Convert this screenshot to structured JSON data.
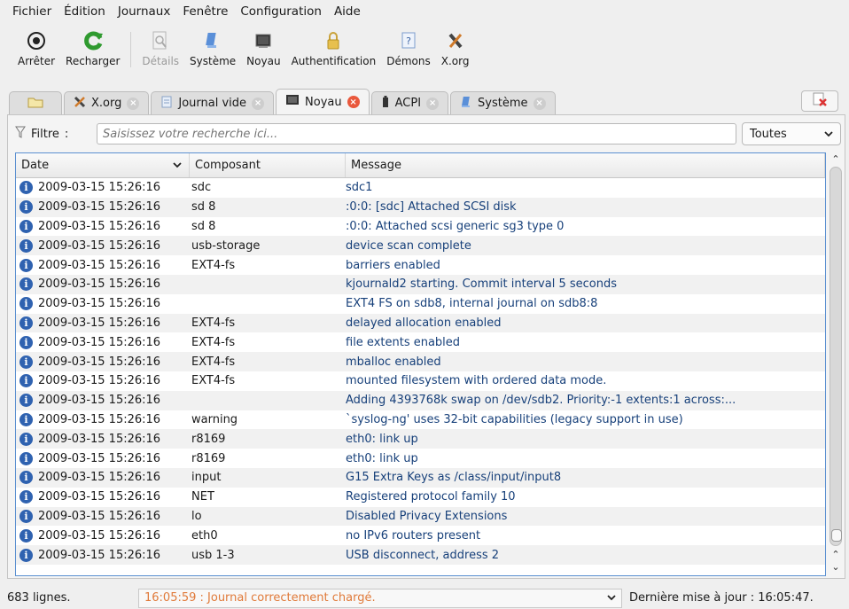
{
  "menubar": {
    "items": [
      "Fichier",
      "Édition",
      "Journaux",
      "Fenêtre",
      "Configuration",
      "Aide"
    ]
  },
  "toolbar": {
    "stop_label": "Arrêter",
    "reload_label": "Recharger",
    "details_label": "Détails",
    "system_label": "Système",
    "kernel_label": "Noyau",
    "auth_label": "Authentification",
    "daemons_label": "Démons",
    "xorg_label": "X.org"
  },
  "tabs": {
    "items": [
      {
        "label": "X.org",
        "active": false
      },
      {
        "label": "Journal vide",
        "active": false
      },
      {
        "label": "Noyau",
        "active": true
      },
      {
        "label": "ACPI",
        "active": false
      },
      {
        "label": "Système",
        "active": false
      }
    ]
  },
  "filter": {
    "label": "Filtre",
    "separator": ":",
    "placeholder": "Saisissez votre recherche ici...",
    "scope": "Toutes"
  },
  "table": {
    "columns": [
      "Date",
      "Composant",
      "Message"
    ],
    "rows": [
      {
        "date": "2009-03-15 15:26:16",
        "component": "sdc",
        "message": "sdc1"
      },
      {
        "date": "2009-03-15 15:26:16",
        "component": "sd 8",
        "message": ":0:0: [sdc] Attached SCSI disk"
      },
      {
        "date": "2009-03-15 15:26:16",
        "component": "sd 8",
        "message": ":0:0: Attached scsi generic sg3 type 0"
      },
      {
        "date": "2009-03-15 15:26:16",
        "component": "usb-storage",
        "message": "device scan complete"
      },
      {
        "date": "2009-03-15 15:26:16",
        "component": "EXT4-fs",
        "message": "barriers enabled"
      },
      {
        "date": "2009-03-15 15:26:16",
        "component": "",
        "message": "kjournald2 starting. Commit interval 5 seconds"
      },
      {
        "date": "2009-03-15 15:26:16",
        "component": "",
        "message": "EXT4 FS on sdb8, internal journal on sdb8:8"
      },
      {
        "date": "2009-03-15 15:26:16",
        "component": "EXT4-fs",
        "message": "delayed allocation enabled"
      },
      {
        "date": "2009-03-15 15:26:16",
        "component": "EXT4-fs",
        "message": "file extents enabled"
      },
      {
        "date": "2009-03-15 15:26:16",
        "component": "EXT4-fs",
        "message": "mballoc enabled"
      },
      {
        "date": "2009-03-15 15:26:16",
        "component": "EXT4-fs",
        "message": "mounted filesystem with ordered data mode."
      },
      {
        "date": "2009-03-15 15:26:16",
        "component": "",
        "message": "Adding 4393768k swap on /dev/sdb2. Priority:-1 extents:1 across:..."
      },
      {
        "date": "2009-03-15 15:26:16",
        "component": "warning",
        "message": "`syslog-ng' uses 32-bit capabilities (legacy support in use)"
      },
      {
        "date": "2009-03-15 15:26:16",
        "component": "r8169",
        "message": "eth0: link up"
      },
      {
        "date": "2009-03-15 15:26:16",
        "component": "r8169",
        "message": "eth0: link up"
      },
      {
        "date": "2009-03-15 15:26:16",
        "component": "input",
        "message": "G15 Extra Keys as /class/input/input8"
      },
      {
        "date": "2009-03-15 15:26:16",
        "component": "NET",
        "message": "Registered protocol family 10"
      },
      {
        "date": "2009-03-15 15:26:16",
        "component": "lo",
        "message": "Disabled Privacy Extensions"
      },
      {
        "date": "2009-03-15 15:26:16",
        "component": "eth0",
        "message": "no IPv6 routers present"
      },
      {
        "date": "2009-03-15 15:26:16",
        "component": "usb 1-3",
        "message": "USB disconnect, address 2"
      }
    ]
  },
  "status": {
    "lines": "683 lignes.",
    "message": "16:05:59 : Journal correctement chargé.",
    "last_update": "Dernière mise à jour : 16:05:47."
  },
  "colors": {
    "accent": "#2f62b0",
    "active_tab_close": "#e9583c",
    "status_text": "#e07a3a",
    "message_text": "#17407a"
  }
}
